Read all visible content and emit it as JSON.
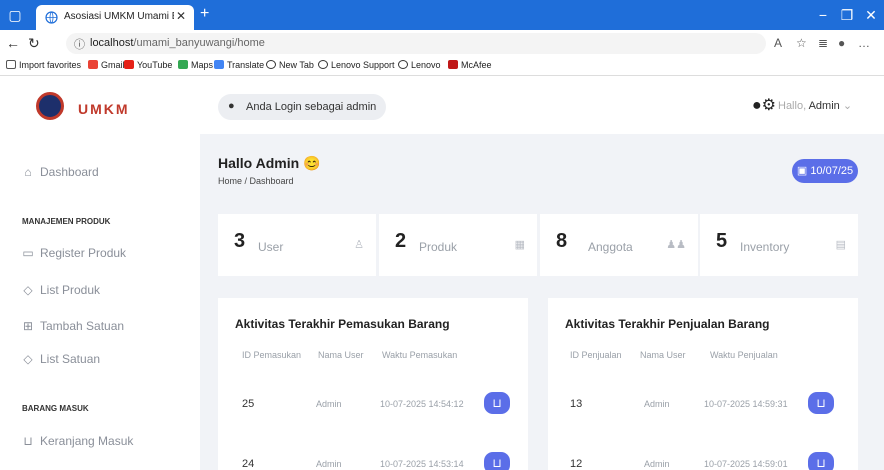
{
  "browser": {
    "tab_title": "Asosiasi UMKM Umami Banyuwa",
    "url_host": "localhost",
    "url_path": "/umami_banyuwangi/home",
    "bookmarks": [
      "Import favorites",
      "Gmail",
      "YouTube",
      "Maps",
      "Translate",
      "New Tab",
      "Lenovo Support",
      "Lenovo",
      "McAfee"
    ]
  },
  "sidebar": {
    "logo_text": "UMKM",
    "dashboard": "Dashboard",
    "section_produk": "MANAJEMEN PRODUK",
    "produk_items": [
      "Register Produk",
      "List Produk",
      "Tambah Satuan",
      "List Satuan"
    ],
    "section_masuk": "BARANG MASUK",
    "masuk_items": [
      "Keranjang Masuk"
    ]
  },
  "topbar": {
    "login_text": "Anda Login sebagai admin",
    "hallo": "Hallo, ",
    "user": "Admin"
  },
  "page": {
    "title": "Hallo Admin",
    "emoji": "😊",
    "breadcrumb": "Home / Dashboard",
    "date": "10/07/25"
  },
  "stats": [
    {
      "num": "3",
      "label": "User"
    },
    {
      "num": "2",
      "label": "Produk"
    },
    {
      "num": "8",
      "label": "Anggota"
    },
    {
      "num": "5",
      "label": "Inventory"
    }
  ],
  "pemasukan": {
    "title": "Aktivitas Terakhir Pemasukan Barang",
    "headers": [
      "ID Pemasukan",
      "Nama User",
      "Waktu Pemasukan"
    ],
    "rows": [
      {
        "id": "25",
        "user": "Admin",
        "time": "10-07-2025 14:54:12"
      },
      {
        "id": "24",
        "user": "Admin",
        "time": "10-07-2025 14:53:14"
      }
    ]
  },
  "penjualan": {
    "title": "Aktivitas Terakhir Penjualan Barang",
    "headers": [
      "ID Penjualan",
      "Nama User",
      "Waktu Penjualan"
    ],
    "rows": [
      {
        "id": "13",
        "user": "Admin",
        "time": "10-07-2025 14:59:31"
      },
      {
        "id": "12",
        "user": "Admin",
        "time": "10-07-2025 14:59:01"
      }
    ]
  },
  "colors": {
    "accent": "#5b6ee8",
    "titlebar": "#1f6ed9",
    "brand": "#c0392b"
  }
}
